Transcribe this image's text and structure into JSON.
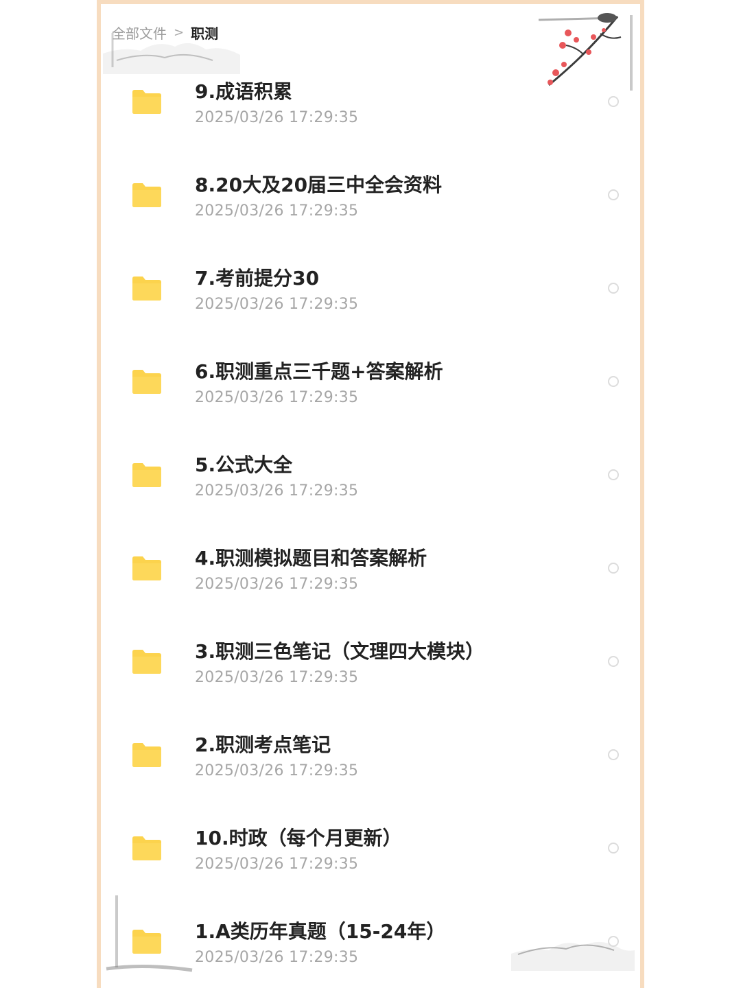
{
  "breadcrumb": {
    "root": "全部文件",
    "separator": ">",
    "current": "职测"
  },
  "files": [
    {
      "name": "9.成语积累",
      "date": "2025/03/26 17:29:35"
    },
    {
      "name": "8.20大及20届三中全会资料",
      "date": "2025/03/26 17:29:35"
    },
    {
      "name": "7.考前提分30",
      "date": "2025/03/26 17:29:35"
    },
    {
      "name": "6.职测重点三千题+答案解析",
      "date": "2025/03/26 17:29:35"
    },
    {
      "name": "5.公式大全",
      "date": "2025/03/26 17:29:35"
    },
    {
      "name": "4.职测模拟题目和答案解析",
      "date": "2025/03/26 17:29:35"
    },
    {
      "name": "3.职测三色笔记（文理四大模块）",
      "date": "2025/03/26 17:29:35"
    },
    {
      "name": "2.职测考点笔记",
      "date": "2025/03/26 17:29:35"
    },
    {
      "name": "10.时政（每个月更新）",
      "date": "2025/03/26 17:29:35"
    },
    {
      "name": "1.A类历年真题（15-24年）",
      "date": "2025/03/26 17:29:35"
    }
  ],
  "icons": {
    "folder": "folder-icon",
    "select": "radio-icon"
  },
  "colors": {
    "folder": "#fcd34d",
    "frame": "#f7dcbf",
    "blossom": "#e8575a"
  }
}
